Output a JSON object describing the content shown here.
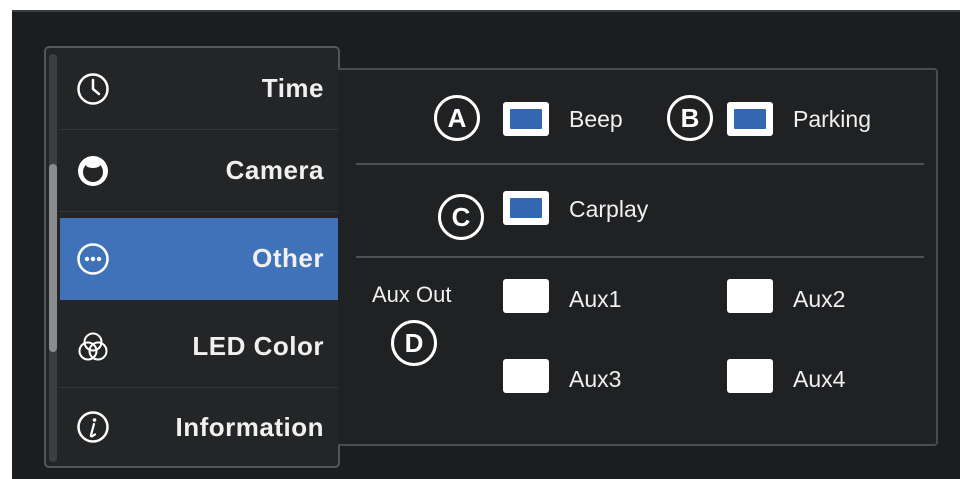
{
  "sidebar": {
    "items": [
      {
        "label": "Time",
        "icon": "clock-icon"
      },
      {
        "label": "Camera",
        "icon": "camera-icon"
      },
      {
        "label": "Other",
        "icon": "more-icon",
        "active": true
      },
      {
        "label": "LED Color",
        "icon": "color-circles-icon"
      },
      {
        "label": "Information",
        "icon": "info-icon"
      }
    ]
  },
  "panel": {
    "badges": {
      "a": "A",
      "b": "B",
      "c": "C",
      "d": "D"
    },
    "beep": {
      "label": "Beep",
      "checked": true
    },
    "parking": {
      "label": "Parking",
      "checked": true
    },
    "carplay": {
      "label": "Carplay",
      "checked": true
    },
    "aux_out": {
      "label": "Aux Out",
      "aux1": {
        "label": "Aux1",
        "checked": false
      },
      "aux2": {
        "label": "Aux2",
        "checked": false
      },
      "aux3": {
        "label": "Aux3",
        "checked": false
      },
      "aux4": {
        "label": "Aux4",
        "checked": false
      }
    }
  },
  "colors": {
    "accent": "#3f72b8",
    "toggle_on": "#3367b2",
    "background": "#1b1d1f"
  }
}
